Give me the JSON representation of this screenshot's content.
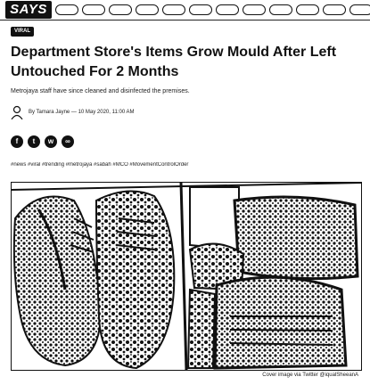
{
  "header": {
    "logo": "SAYS",
    "nav_items": [
      "",
      "",
      "",
      "",
      "",
      "",
      "",
      "",
      "",
      "",
      "",
      ""
    ]
  },
  "article": {
    "category": "VIRAL",
    "title": "Department Store's Items Grow Mould After Left Untouched For 2 Months",
    "subtitle": "Metrojaya staff have since cleaned and disinfected the premises.",
    "byline": "By Tamara Jayne — 10 May 2020, 11:00 AM",
    "share_icons": [
      "facebook-icon",
      "twitter-icon",
      "whatsapp-icon",
      "link-icon"
    ],
    "hashtags": "#news #viral #trending #metrojaya #sabah #MCO #MovementControlOrder",
    "image_credit": "Cover image via Twitter @iqualSheeanA"
  }
}
